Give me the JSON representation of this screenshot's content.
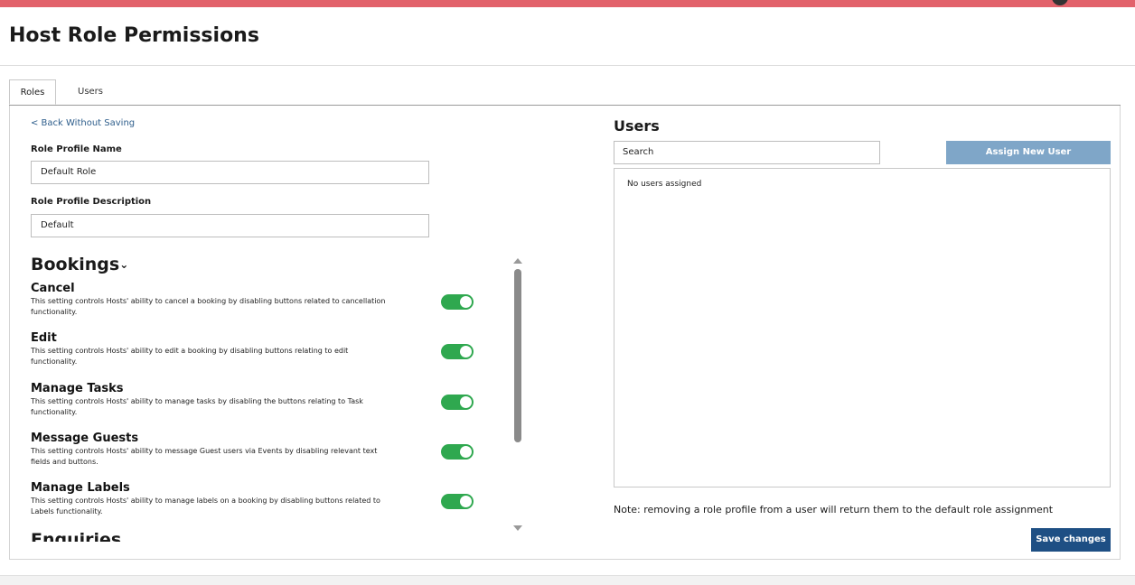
{
  "page": {
    "title": "Host Role Permissions"
  },
  "tabs": [
    {
      "label": "Roles",
      "active": true
    },
    {
      "label": "Users",
      "active": false
    }
  ],
  "form": {
    "back_link": "< Back Without Saving",
    "profile_name_label": "Role Profile Name",
    "profile_name_value": "Default Role",
    "profile_desc_label": "Role Profile Description",
    "profile_desc_value": "Default"
  },
  "sections": [
    {
      "heading": "Bookings",
      "permissions": [
        {
          "title": "Cancel",
          "description": "This setting controls Hosts' ability to cancel a booking by disabling buttons related to cancellation functionality.",
          "enabled": true
        },
        {
          "title": "Edit",
          "description": "This setting controls Hosts' ability to edit a booking by disabling buttons relating to edit functionality.",
          "enabled": true
        },
        {
          "title": "Manage Tasks",
          "description": "This setting controls Hosts' ability to manage tasks by disabling the buttons relating to Task functionality.",
          "enabled": true
        },
        {
          "title": "Message Guests",
          "description": "This setting controls Hosts' ability to message Guest users via Events by disabling relevant text fields and buttons.",
          "enabled": true
        },
        {
          "title": "Manage Labels",
          "description": "This setting controls Hosts' ability to manage labels on a booking by disabling buttons related to Labels functionality.",
          "enabled": true
        }
      ]
    },
    {
      "heading": "Enquiries"
    }
  ],
  "users_panel": {
    "heading": "Users",
    "search_placeholder": "Search",
    "assign_button": "Assign New User",
    "empty_text": "No users assigned",
    "note": "Note: removing a role profile from a user will return them to the default role assignment",
    "save_button": "Save changes"
  },
  "colors": {
    "topbar": "#e2626b",
    "toggle_on": "#2fa84f",
    "primary_button": "#1e4f84",
    "secondary_button": "#7fa6c8",
    "link": "#2d5d8b"
  }
}
